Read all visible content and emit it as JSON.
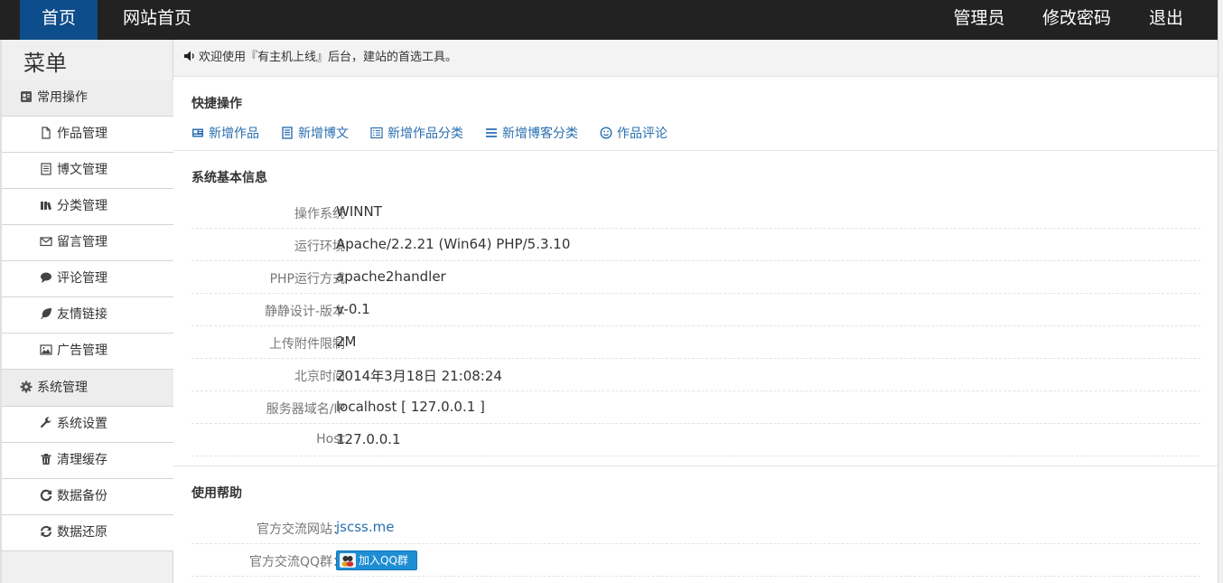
{
  "topnav": {
    "home": "首页",
    "site_home": "网站首页",
    "admin": "管理员",
    "change_password": "修改密码",
    "logout": "退出"
  },
  "sidebar": {
    "title": "菜单",
    "groups": [
      {
        "label": "常用操作",
        "icon": "user-card-icon",
        "items": [
          {
            "label": "作品管理",
            "icon": "file-icon"
          },
          {
            "label": "博文管理",
            "icon": "document-icon"
          },
          {
            "label": "分类管理",
            "icon": "books-icon"
          },
          {
            "label": "留言管理",
            "icon": "envelope-icon"
          },
          {
            "label": "评论管理",
            "icon": "comment-icon"
          },
          {
            "label": "友情链接",
            "icon": "leaf-icon"
          },
          {
            "label": "广告管理",
            "icon": "picture-icon"
          }
        ]
      },
      {
        "label": "系统管理",
        "icon": "gear-icon",
        "items": [
          {
            "label": "系统设置",
            "icon": "wrench-icon"
          },
          {
            "label": "清理缓存",
            "icon": "trash-icon"
          },
          {
            "label": "数据备份",
            "icon": "refresh-icon"
          },
          {
            "label": "数据还原",
            "icon": "retweet-icon"
          }
        ]
      }
    ]
  },
  "welcome": {
    "text": "欢迎使用『有主机上线』后台，建站的首选工具。",
    "icon": "volume-icon"
  },
  "quick_actions": {
    "title": "快捷操作",
    "items": [
      {
        "label": "新增作品",
        "icon": "card-icon"
      },
      {
        "label": "新增博文",
        "icon": "document-icon"
      },
      {
        "label": "新增作品分类",
        "icon": "list-box-icon"
      },
      {
        "label": "新增博客分类",
        "icon": "list-icon"
      },
      {
        "label": "作品评论",
        "icon": "smile-icon"
      }
    ]
  },
  "system_info": {
    "title": "系统基本信息",
    "rows": [
      {
        "label": "操作系统",
        "value": "WINNT"
      },
      {
        "label": "运行环境",
        "value": "Apache/2.2.21 (Win64) PHP/5.3.10"
      },
      {
        "label": "PHP运行方式",
        "value": "apache2handler"
      },
      {
        "label": "静静设计-版本",
        "value": "v-0.1"
      },
      {
        "label": "上传附件限制",
        "value": "2M"
      },
      {
        "label": "北京时间",
        "value": "2014年3月18日 21:08:24"
      },
      {
        "label": "服务器域名/IP",
        "value": "localhost [ 127.0.0.1 ]"
      },
      {
        "label": "Host",
        "value": "127.0.0.1"
      }
    ]
  },
  "help": {
    "title": "使用帮助",
    "site_label": "官方交流网站：",
    "site_value": "jscss.me",
    "qq_label": "官方交流QQ群：",
    "qq_button": "加入QQ群"
  },
  "colors": {
    "topbar": "#222222",
    "nav_active": "#0e4d8b",
    "link": "#2a6fb0",
    "sidebar_bg": "#f0f0f0"
  }
}
